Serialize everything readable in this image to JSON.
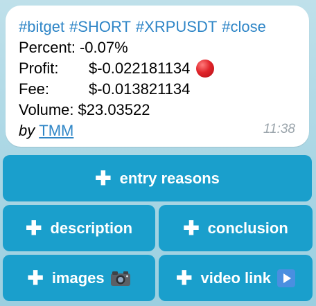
{
  "message": {
    "hashtags": [
      "#bitget",
      "#SHORT",
      "#XRPUSDT",
      "#close"
    ],
    "percent_label": "Percent:",
    "percent_value": "-0.07%",
    "profit_label": "Profit:",
    "profit_value": "$-0.022181134",
    "profit_status_icon": "red-circle-icon",
    "fee_label": "Fee:",
    "fee_value": "$-0.013821134",
    "volume_label": "Volume:",
    "volume_value": "$23.03522",
    "by_label": "by",
    "author": "TMM",
    "time": "11:38"
  },
  "buttons": {
    "entry_reasons": "entry reasons",
    "description": "description",
    "conclusion": "conclusion",
    "images": "images",
    "video_link": "video link"
  },
  "colors": {
    "link": "#2f86c7",
    "button_bg": "#1a9fcc",
    "status_red": "#e0242a"
  }
}
